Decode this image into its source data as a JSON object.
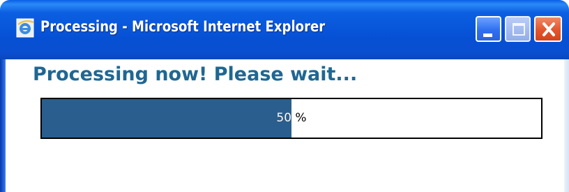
{
  "window": {
    "title": "Processing - Microsoft Internet Explorer",
    "app_icon": "internet-explorer-icon",
    "controls": {
      "minimize_icon": "minimize-icon",
      "maximize_icon": "maximize-icon",
      "close_icon": "close-icon"
    }
  },
  "main": {
    "heading": "Processing now! Please wait...",
    "progress": {
      "value": 50,
      "label": "50 %",
      "fill_color": "#2a5e8e"
    }
  },
  "colors": {
    "heading": "#1f6792",
    "titlebar": "#0650d4"
  }
}
